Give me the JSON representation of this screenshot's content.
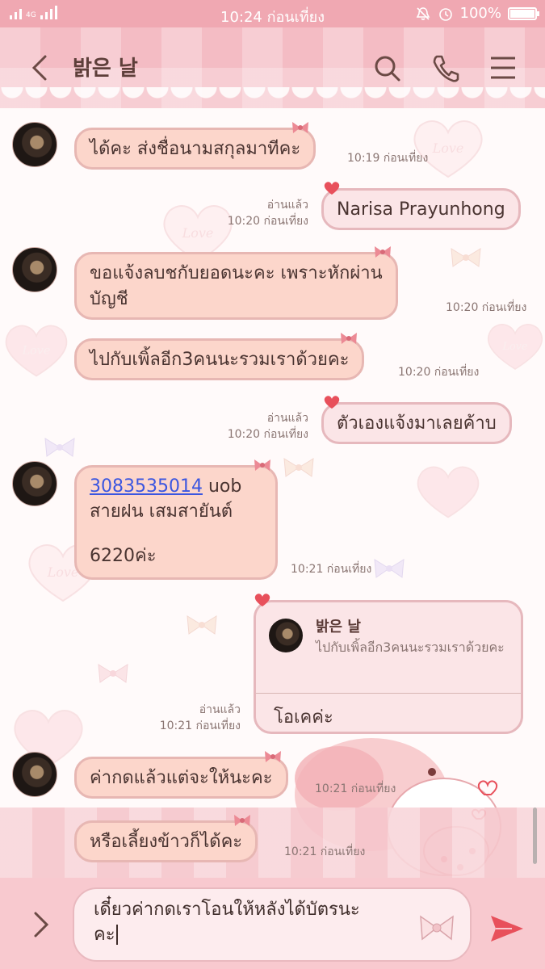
{
  "status_bar": {
    "network": "4G",
    "time": "10:24 ก่อนเที่ยง",
    "battery": "100%",
    "battery_level": 1.0
  },
  "header": {
    "title": "밝은 날",
    "icons": [
      "back-icon",
      "search-icon",
      "phone-icon",
      "menu-icon"
    ]
  },
  "messages": [
    {
      "side": "left",
      "text": "ได้คะ ส่งชื่อนามสกุลมาทีคะ",
      "time": "10:19 ก่อนเที่ยง"
    },
    {
      "side": "right",
      "text": "Narisa Prayunhong",
      "read": "อ่านแล้ว",
      "time": "10:20 ก่อนเที่ยง"
    },
    {
      "side": "left",
      "lines": [
        "ขอแจ้งลบชกับยอดนะคะ เพราะหักผ่าน",
        "บัญชี"
      ],
      "time": "10:20 ก่อนเที่ยง"
    },
    {
      "side": "left",
      "text": "ไปกับเพิ้ลอีก3คนนะรวมเราด้วยคะ",
      "time": "10:20 ก่อนเที่ยง"
    },
    {
      "side": "right",
      "text": "ตัวเองแจ้งมาเลยค้าบ",
      "read": "อ่านแล้ว",
      "time": "10:20 ก่อนเที่ยง"
    },
    {
      "side": "left",
      "link": "3083535014",
      "link_suffix": " uob",
      "line2": "สายฝน เสมสายันต์",
      "line3": "6220ค่ะ",
      "time": "10:21 ก่อนเที่ยง"
    },
    {
      "side": "right",
      "reply_name": "밝은 날",
      "reply_text": "ไปกับเพิ้ลอีก3คนนะรวมเราด้วยคะ",
      "text": "โอเคค่ะ",
      "read": "อ่านแล้ว",
      "time": "10:21 ก่อนเที่ยง"
    },
    {
      "side": "left",
      "text": "ค่ากดแล้วแต่จะให้นะคะ",
      "time": "10:21 ก่อนเที่ยง"
    },
    {
      "side": "left",
      "text": "หรือเลี้ยงข้าวก็ได้คะ",
      "time": "10:21 ก่อนเที่ยง"
    }
  ],
  "background_word": "Love",
  "input": {
    "value_line1": "เดี๋ยวค่ากดเราโอนให้หลังได้บัตรนะ",
    "value_line2": "คะ"
  },
  "colors": {
    "accent": "#e8505b",
    "bubble_left": "#fcd6cb",
    "bubble_right": "#fbe5e7",
    "header": "#f4bcc4"
  }
}
